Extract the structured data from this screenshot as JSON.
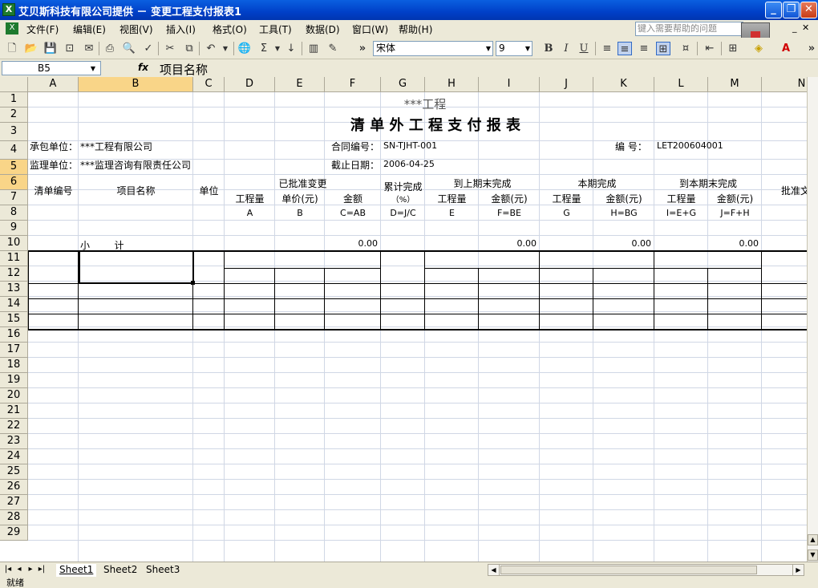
{
  "window": {
    "title": "艾贝斯科技有限公司提供 － 变更工程支付报表1",
    "app_icon_letter": "X"
  },
  "menu": [
    "文件(F)",
    "编辑(E)",
    "视图(V)",
    "插入(I)",
    "格式(O)",
    "工具(T)",
    "数据(D)",
    "窗口(W)",
    "帮助(H)"
  ],
  "help_placeholder": "键入需要帮助的问题",
  "font": {
    "name": "宋体",
    "size": "9"
  },
  "namebox": "B5",
  "formula": "项目名称",
  "columns": [
    "A",
    "B",
    "C",
    "D",
    "E",
    "F",
    "G",
    "H",
    "I",
    "J",
    "K",
    "L",
    "M",
    "N"
  ],
  "rows": [
    "1",
    "2",
    "3",
    "4",
    "5",
    "6",
    "7",
    "8",
    "9",
    "10",
    "11",
    "12",
    "13",
    "14",
    "15",
    "16",
    "17",
    "18",
    "19",
    "20",
    "21",
    "22",
    "23",
    "24",
    "25",
    "26",
    "27",
    "28",
    "29"
  ],
  "sheet": {
    "project": "***工程",
    "report_title": "清 单 外 工 程 支 付 报 表",
    "contractor_label": "承包单位：",
    "contractor_value": "***工程有限公司",
    "contract_no_label": "合同编号：",
    "contract_no_value": "SN-TJHT-001",
    "number_label": "编    号：",
    "number_value": "LET200604001",
    "supervisor_label": "监理单位：",
    "supervisor_value": "***监理咨询有限责任公司",
    "deadline_label": "截止日期：",
    "deadline_value": "2006-04-25",
    "h_item_no": "清单编号",
    "h_item_name": "项目名称",
    "h_unit": "单位",
    "h_approved": "已批准变更",
    "h_cumulative": "累计完成",
    "h_pct": "（%）",
    "h_prev_end": "到上期末完成",
    "h_current": "本期完成",
    "h_this_end": "到本期末完成",
    "h_approved_right": "批准文",
    "h_qty1": "工程量",
    "h_price": "单价(元)",
    "h_amount1": "金额",
    "h_qty2": "工程量",
    "h_amount2": "金额(元)",
    "h_qty3": "工程量",
    "h_amount3": "金额(元)",
    "h_qty4": "工程量",
    "h_amount4": "金额(元)",
    "f_a": "A",
    "f_b": "B",
    "f_c": "C=AB",
    "f_d": "D=J/C",
    "f_e": "E",
    "f_f": "F=BE",
    "f_g": "G",
    "f_h": "H=BG",
    "f_i": "I=E+G",
    "f_j": "J=F+H",
    "subtotal_label": "小        计",
    "subtotal_c": "0.00",
    "subtotal_f": "0.00",
    "subtotal_h": "0.00",
    "subtotal_j": "0.00"
  },
  "tabs": [
    "Sheet1",
    "Sheet2",
    "Sheet3"
  ],
  "status": "就绪"
}
